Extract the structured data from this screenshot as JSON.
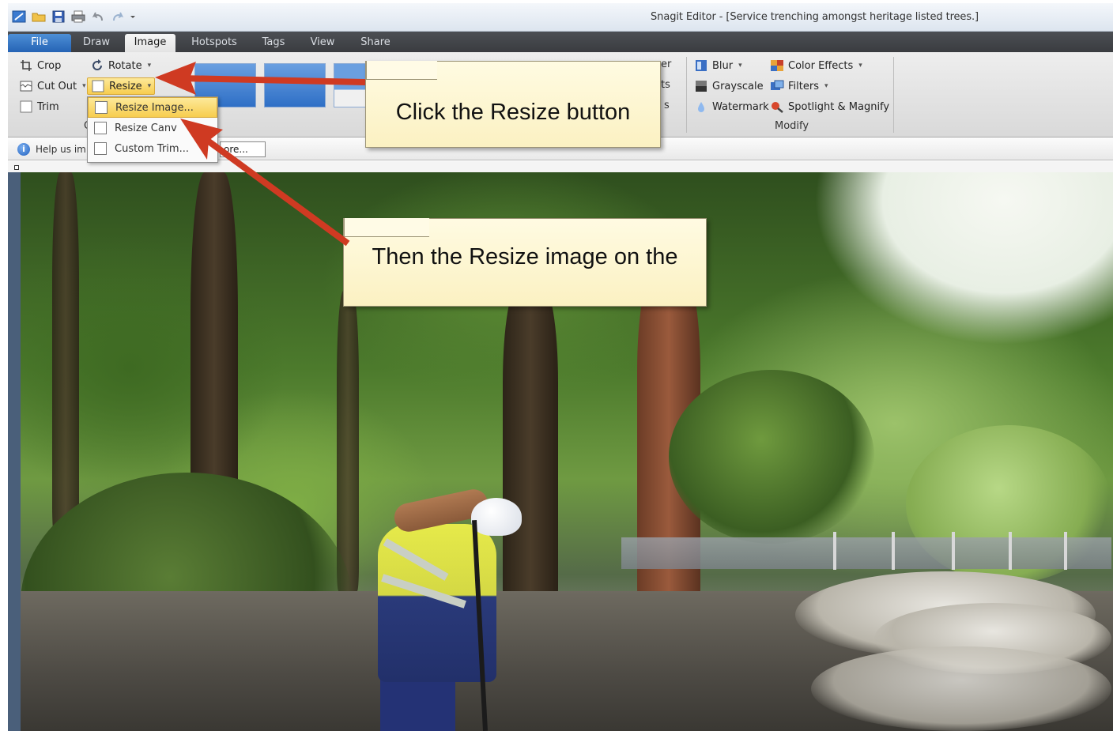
{
  "window": {
    "title": "Snagit Editor - [Service trenching amongst heritage listed trees.]"
  },
  "tabs": [
    {
      "label": "File"
    },
    {
      "label": "Draw"
    },
    {
      "label": "Image"
    },
    {
      "label": "Hotspots"
    },
    {
      "label": "Tags"
    },
    {
      "label": "View"
    },
    {
      "label": "Share"
    }
  ],
  "ribbon": {
    "crop": "Crop",
    "rotate": "Rotate",
    "cut_out": "Cut Out",
    "resize": "Resize",
    "trim": "Trim",
    "group_canvas_fragment": "C",
    "partial_left_1": "er",
    "partial_left_2": "ts",
    "partial_left_3": "s",
    "blur": "Blur",
    "grayscale": "Grayscale",
    "watermark": "Watermark",
    "color_effects": "Color Effects",
    "filters": "Filters",
    "spotlight": "Spotlight & Magnify",
    "group_modify": "Modify"
  },
  "resize_menu": {
    "items": [
      "Resize Image...",
      "Resize Canv",
      "Custom Trim..."
    ]
  },
  "infobar": {
    "text": "Help us im",
    "more": "ore..."
  },
  "callouts": {
    "first": "Click the Resize button",
    "second": "Then the Resize image on the"
  },
  "colors": {
    "tab_active": "#e6e6e6",
    "file_tab": "#2f6fc0",
    "highlight": "#f7cd4e",
    "callout": "#fcf4cc",
    "arrow": "#cf3a22"
  }
}
